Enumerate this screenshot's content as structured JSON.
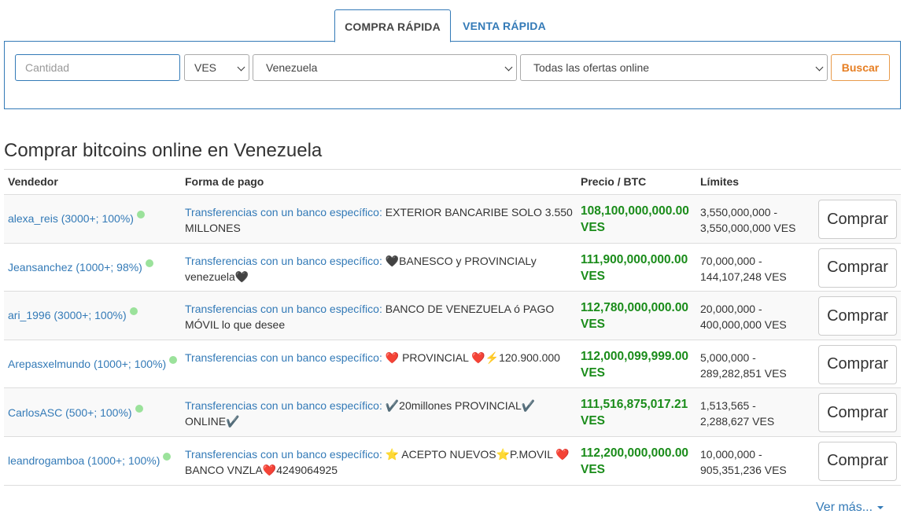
{
  "tabs": {
    "quick_buy": "COMPRA RÁPIDA",
    "quick_sell": "VENTA RÁPIDA"
  },
  "search": {
    "amount_placeholder": "Cantidad",
    "currency": "VES",
    "country": "Venezuela",
    "offers": "Todas las ofertas online",
    "button": "Buscar"
  },
  "page_title": "Comprar bitcoins online en Venezuela",
  "columns": {
    "seller": "Vendedor",
    "payment": "Forma de pago",
    "price": "Precio / BTC",
    "limits": "Límites"
  },
  "rows": [
    {
      "seller": "alexa_reis (3000+; 100%)",
      "method": "Transferencias con un banco específico:",
      "details": " EXTERIOR BANCARIBE SOLO 3.550 MILLONES",
      "price": "108,100,000,000.00",
      "currency": "VES",
      "limits_line1": "3,550,000,000 -",
      "limits_line2": "3,550,000,000 VES",
      "buy": "Comprar"
    },
    {
      "seller": "Jeansanchez (1000+; 98%)",
      "method": "Transferencias con un banco específico:",
      "details": " 🖤BANESCO y PROVINCIALy venezuela🖤",
      "price": "111,900,000,000.00",
      "currency": "VES",
      "limits_line1": "70,000,000 -",
      "limits_line2": "144,107,248 VES",
      "buy": "Comprar"
    },
    {
      "seller": "ari_1996 (3000+; 100%)",
      "method": "Transferencias con un banco específico:",
      "details": " BANCO DE VENEZUELA ó PAGO MÓVIL lo que desee",
      "price": "112,780,000,000.00",
      "currency": "VES",
      "limits_line1": "20,000,000 -",
      "limits_line2": "400,000,000 VES",
      "buy": "Comprar"
    },
    {
      "seller": "Arepasxelmundo (1000+; 100%)",
      "method": "Transferencias con un banco específico:",
      "details": " ❤️ PROVINCIAL ❤️⚡120.900.000",
      "price": "112,000,099,999.00",
      "currency": "VES",
      "limits_line1": "5,000,000 -",
      "limits_line2": "289,282,851 VES",
      "buy": "Comprar"
    },
    {
      "seller": "CarlosASC (500+; 100%)",
      "method": "Transferencias con un banco específico:",
      "details": " ✔️20millones PROVINCIAL✔️ ONLINE✔️",
      "price": "111,516,875,017.21",
      "currency": "VES",
      "limits_line1": "1,513,565 -",
      "limits_line2": "2,288,627 VES",
      "buy": "Comprar"
    },
    {
      "seller": "leandrogamboa (1000+; 100%)",
      "method": "Transferencias con un banco específico:",
      "details": " ⭐ ACEPTO NUEVOS⭐P.MOVIL ❤️BANCO VNZLA❤️4249064925",
      "price": "112,200,000,000.00",
      "currency": "VES",
      "limits_line1": "10,000,000 -",
      "limits_line2": "905,351,236 VES",
      "buy": "Comprar"
    }
  ],
  "see_more": "Ver más..."
}
